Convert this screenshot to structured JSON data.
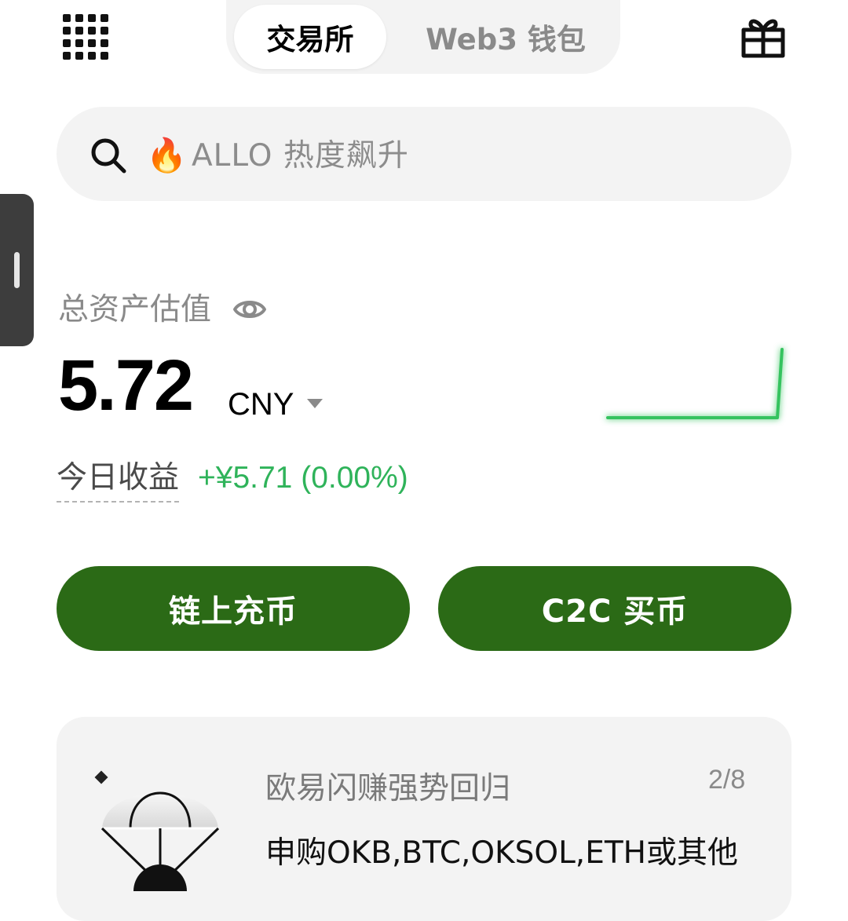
{
  "header": {
    "tabs": [
      {
        "label": "交易所",
        "active": true
      },
      {
        "label": "Web3 钱包",
        "active": false
      }
    ],
    "menu_icon": "grid-icon",
    "gift_icon": "gift-icon"
  },
  "search": {
    "icon": "search-icon",
    "prefix_icon": "fire-icon",
    "prefix_glyph": "🔥",
    "placeholder": "ALLO 热度飙升"
  },
  "assets": {
    "label": "总资产估值",
    "value": "5.72",
    "currency": "CNY",
    "today_label": "今日收益",
    "today_pnl": "+¥5.71 (0.00%)",
    "pnl_color": "#2fb35a"
  },
  "actions": {
    "deposit_label": "链上充币",
    "c2c_label": "C2C 买币",
    "button_color": "#2b6a16"
  },
  "promo": {
    "title": "欧易闪赚强势回归",
    "counter": "2/8",
    "body": "申购OKB,BTC,OKSOL,ETH或其他"
  }
}
